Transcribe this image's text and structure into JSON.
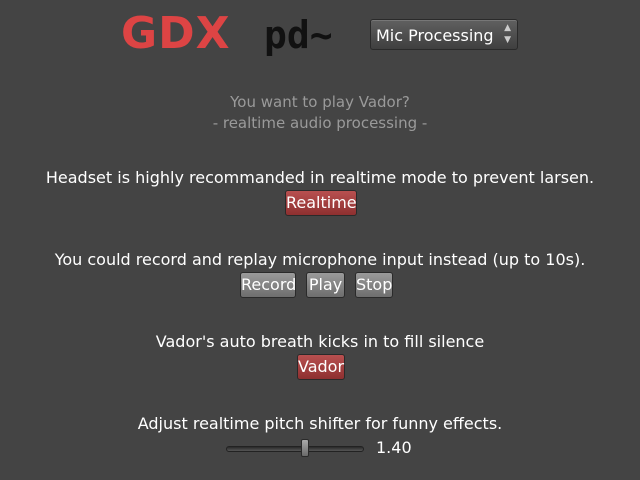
{
  "logo": {
    "brand": "GDX",
    "product": "pd~"
  },
  "processing_select": {
    "selected": "Mic Processing"
  },
  "intro": {
    "title": "You want to play Vador?",
    "subtitle": "- realtime audio processing -"
  },
  "realtime": {
    "message": "Headset is highly recommanded in realtime mode to prevent larsen.",
    "button_label": "Realtime"
  },
  "recording": {
    "message": "You could record and replay microphone input instead (up to 10s).",
    "record_label": "Record",
    "play_label": "Play",
    "stop_label": "Stop"
  },
  "breath": {
    "message": "Vador's auto breath kicks in to fill silence",
    "button_label": "Vador"
  },
  "pitch": {
    "message": "Adjust realtime pitch shifter for funny effects.",
    "value_label": "1.40",
    "fraction": 0.58
  },
  "colors": {
    "background": "#444444",
    "accent_red": "#a84040",
    "logo_red": "#dd4444"
  }
}
